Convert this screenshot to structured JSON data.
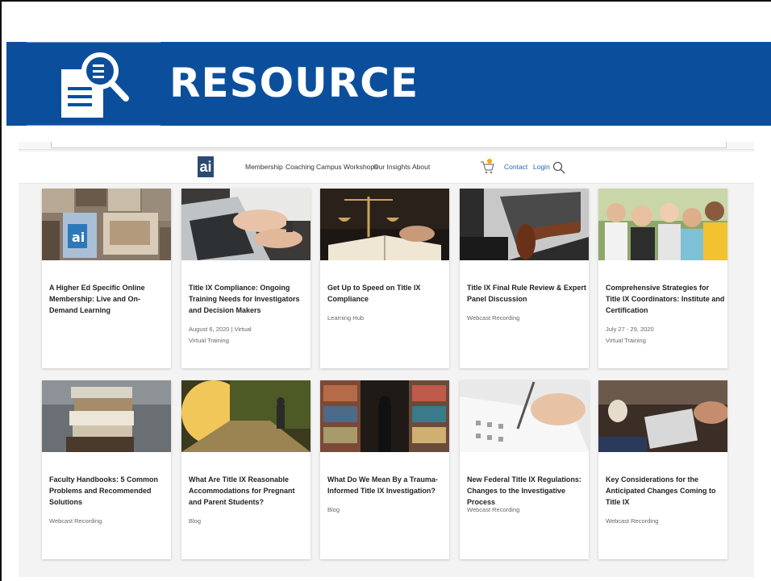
{
  "slide": {
    "title": "RESOURCE"
  },
  "nav": {
    "logo": "ai",
    "items": [
      "Membership",
      "Coaching",
      "Campus Workshops",
      "Our Insights",
      "About"
    ],
    "contact": "Contact",
    "login": "Login",
    "cart_count": "0"
  },
  "cards": [
    {
      "title": "A Higher Ed Specific Online Membership: Live and On-Demand Learning",
      "meta1": "",
      "meta2": "",
      "image": "photo-collage"
    },
    {
      "title": "Title IX Compliance: Ongoing Training Needs for Investigators and Decision Makers",
      "meta1": "August 6, 2020 | Virtual",
      "meta2": "Virtual Training",
      "image": "laptop-typing"
    },
    {
      "title": "Get Up to Speed on Title IX Compliance",
      "meta1": "Learning Hub",
      "meta2": "",
      "image": "scales-book"
    },
    {
      "title": "Title IX Final Rule Review & Expert Panel Discussion",
      "meta1": "Webcast Recording",
      "meta2": "",
      "image": "gavel-laptop"
    },
    {
      "title": "Comprehensive Strategies for Title IX Coordinators: Institute and Certification",
      "meta1": "July 27 - 29, 2020",
      "meta2": "Virtual Training",
      "image": "students-group"
    },
    {
      "title": "Faculty Handbooks: 5 Common Problems and Recommended Solutions",
      "meta1": "Webcast Recording",
      "meta2": "",
      "image": "book-stack"
    },
    {
      "title": "What Are Title IX Reasonable Accommodations for Pregnant and Parent Students?",
      "meta1": "Blog",
      "meta2": "",
      "image": "park-path"
    },
    {
      "title": "What Do We Mean By a Trauma-Informed Title IX Investigation?",
      "meta1": "Blog",
      "meta2": "",
      "image": "library-shelves"
    },
    {
      "title": "New Federal Title IX Regulations: Changes to the Investigative Process",
      "meta1": "Webcast Recording",
      "meta2": "",
      "image": "writing-form"
    },
    {
      "title": "Key Considerations for the Anticipated Changes Coming to Title IX",
      "meta1": "Webcast Recording",
      "meta2": "",
      "image": "meeting-table"
    }
  ],
  "colors": {
    "banner": "#0b4f9c",
    "link": "#2b64b5"
  }
}
